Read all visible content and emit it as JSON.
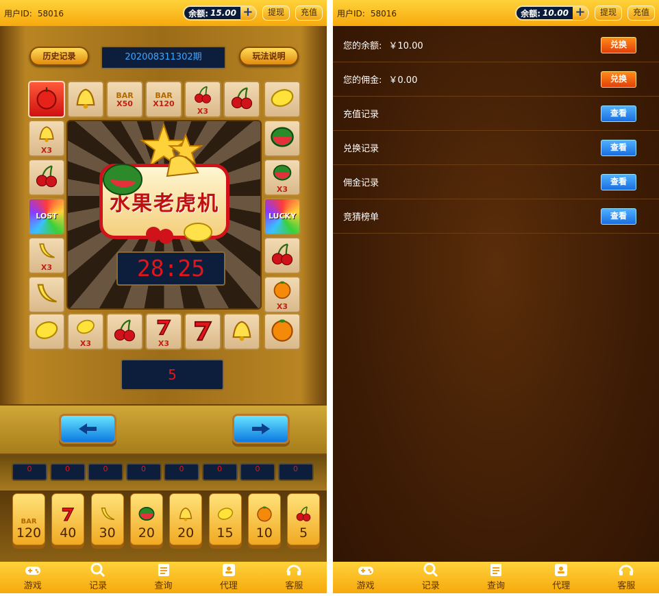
{
  "left": {
    "header": {
      "uid_label": "用户ID:",
      "uid": "58016",
      "balance_label": "余额:",
      "balance": "15.00",
      "plus": "+",
      "withdraw": "提现",
      "recharge": "充值"
    },
    "history_btn": "历史记录",
    "rules_btn": "玩法说明",
    "period": "202008311302期",
    "logo": "水果老虎机",
    "timer": "28:25",
    "count": "5",
    "board": {
      "top": [
        {
          "sym": "apple-icon",
          "mult": "",
          "active": true
        },
        {
          "sym": "bell-icon",
          "mult": ""
        },
        {
          "sym": "bar",
          "mult": "X50"
        },
        {
          "sym": "bar",
          "mult": "X120"
        },
        {
          "sym": "cherry-icon",
          "mult": "X3"
        },
        {
          "sym": "cherry-icon",
          "mult": ""
        },
        {
          "sym": "lemon-icon",
          "mult": ""
        }
      ],
      "left": [
        {
          "sym": "bell-icon",
          "mult": "X3"
        },
        {
          "sym": "cherry-icon",
          "mult": ""
        },
        {
          "sym": "lost",
          "mult": ""
        },
        {
          "sym": "banana-icon",
          "mult": "X3"
        },
        {
          "sym": "banana-icon",
          "mult": ""
        }
      ],
      "right": [
        {
          "sym": "watermelon-icon",
          "mult": ""
        },
        {
          "sym": "watermelon-icon",
          "mult": "X3"
        },
        {
          "sym": "lucky",
          "mult": ""
        },
        {
          "sym": "cherry-icon",
          "mult": ""
        },
        {
          "sym": "orange-icon",
          "mult": "X3"
        }
      ],
      "bottom": [
        {
          "sym": "lemon-icon",
          "mult": ""
        },
        {
          "sym": "lemon-icon",
          "mult": "X3"
        },
        {
          "sym": "cherry-icon",
          "mult": ""
        },
        {
          "sym": "seven-icon",
          "mult": "X3"
        },
        {
          "sym": "seven-icon",
          "mult": ""
        },
        {
          "sym": "bell-icon",
          "mult": ""
        },
        {
          "sym": "orange-icon",
          "mult": ""
        }
      ]
    },
    "bets": [
      "0",
      "0",
      "0",
      "0",
      "0",
      "0",
      "0",
      "0"
    ],
    "odds": [
      {
        "sym": "BAR",
        "val": "120"
      },
      {
        "sym": "7",
        "val": "40"
      },
      {
        "sym": "banana",
        "val": "30"
      },
      {
        "sym": "watermelon",
        "val": "20"
      },
      {
        "sym": "bell",
        "val": "20"
      },
      {
        "sym": "lemon",
        "val": "15"
      },
      {
        "sym": "orange",
        "val": "10"
      },
      {
        "sym": "cherry",
        "val": "5"
      }
    ],
    "lost_label": "LOST",
    "lucky_label": "LUCKY",
    "bar_label": "BAR"
  },
  "right": {
    "header": {
      "uid_label": "用户ID:",
      "uid": "58016",
      "balance_label": "余额:",
      "balance": "10.00",
      "plus": "+",
      "withdraw": "提现",
      "recharge": "充值"
    },
    "rows": [
      {
        "label": "您的余额:",
        "value": "￥10.00",
        "btn": "兑换",
        "style": "orange"
      },
      {
        "label": "您的佣金:",
        "value": "￥0.00",
        "btn": "兑换",
        "style": "orange"
      },
      {
        "label": "充值记录",
        "value": "",
        "btn": "查看",
        "style": "blue"
      },
      {
        "label": "兑换记录",
        "value": "",
        "btn": "查看",
        "style": "blue"
      },
      {
        "label": "佣金记录",
        "value": "",
        "btn": "查看",
        "style": "blue"
      },
      {
        "label": "竞猜榜单",
        "value": "",
        "btn": "查看",
        "style": "blue"
      }
    ]
  },
  "nav": [
    {
      "label": "游戏",
      "icon": "gamepad-icon"
    },
    {
      "label": "记录",
      "icon": "search-icon"
    },
    {
      "label": "查询",
      "icon": "notepad-icon"
    },
    {
      "label": "代理",
      "icon": "agent-icon"
    },
    {
      "label": "客服",
      "icon": "headset-icon"
    }
  ],
  "colors": {
    "header_yellow": "#f6a90d",
    "digit_red": "#e3141a",
    "period_blue": "#3fa6ff",
    "orange_btn": "#e2400a",
    "blue_btn": "#1a6ee0"
  }
}
